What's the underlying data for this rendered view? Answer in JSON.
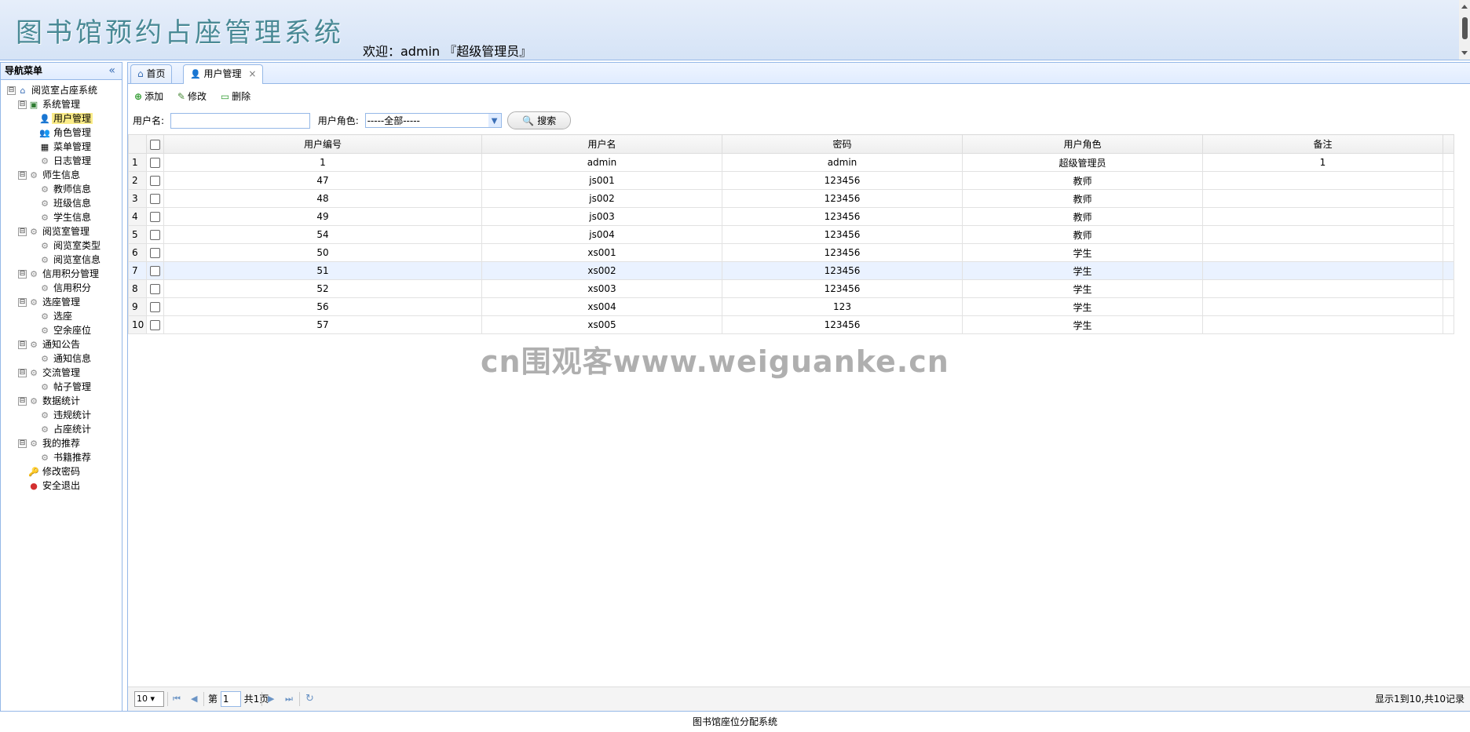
{
  "header": {
    "system_title": "图书馆预约占座管理系统",
    "welcome": "欢迎：admin 『超级管理员』"
  },
  "sidebar": {
    "title": "导航菜单",
    "tree": [
      {
        "label": "阅览室占座系统",
        "level": 0,
        "icon": "home-icon",
        "glyph": "⌂",
        "expander": "⊟"
      },
      {
        "label": "系统管理",
        "level": 1,
        "icon": "folder-icon",
        "glyph": "▣",
        "expander": "⊟"
      },
      {
        "label": "用户管理",
        "level": 2,
        "icon": "user-icon",
        "glyph": "👤",
        "selected": true
      },
      {
        "label": "角色管理",
        "level": 2,
        "icon": "role-icon",
        "glyph": "👥"
      },
      {
        "label": "菜单管理",
        "level": 2,
        "icon": "menu-icon",
        "glyph": "▦"
      },
      {
        "label": "日志管理",
        "level": 2,
        "icon": "gear-icon",
        "glyph": "⚙"
      },
      {
        "label": "师生信息",
        "level": 1,
        "icon": "gear-icon",
        "glyph": "⚙",
        "expander": "⊟"
      },
      {
        "label": "教师信息",
        "level": 2,
        "icon": "gear-icon",
        "glyph": "⚙"
      },
      {
        "label": "班级信息",
        "level": 2,
        "icon": "gear-icon",
        "glyph": "⚙"
      },
      {
        "label": "学生信息",
        "level": 2,
        "icon": "gear-icon",
        "glyph": "⚙"
      },
      {
        "label": "阅览室管理",
        "level": 1,
        "icon": "gear-icon",
        "glyph": "⚙",
        "expander": "⊟"
      },
      {
        "label": "阅览室类型",
        "level": 2,
        "icon": "gear-icon",
        "glyph": "⚙"
      },
      {
        "label": "阅览室信息",
        "level": 2,
        "icon": "gear-icon",
        "glyph": "⚙"
      },
      {
        "label": "信用积分管理",
        "level": 1,
        "icon": "gear-icon",
        "glyph": "⚙",
        "expander": "⊟"
      },
      {
        "label": "信用积分",
        "level": 2,
        "icon": "gear-icon",
        "glyph": "⚙"
      },
      {
        "label": "选座管理",
        "level": 1,
        "icon": "gear-icon",
        "glyph": "⚙",
        "expander": "⊟"
      },
      {
        "label": "选座",
        "level": 2,
        "icon": "gear-icon",
        "glyph": "⚙"
      },
      {
        "label": "空余座位",
        "level": 2,
        "icon": "gear-icon",
        "glyph": "⚙"
      },
      {
        "label": "通知公告",
        "level": 1,
        "icon": "gear-icon",
        "glyph": "⚙",
        "expander": "⊟"
      },
      {
        "label": "通知信息",
        "level": 2,
        "icon": "gear-icon",
        "glyph": "⚙"
      },
      {
        "label": "交流管理",
        "level": 1,
        "icon": "gear-icon",
        "glyph": "⚙",
        "expander": "⊟"
      },
      {
        "label": "帖子管理",
        "level": 2,
        "icon": "gear-icon",
        "glyph": "⚙"
      },
      {
        "label": "数据统计",
        "level": 1,
        "icon": "gear-icon",
        "glyph": "⚙",
        "expander": "⊟"
      },
      {
        "label": "违规统计",
        "level": 2,
        "icon": "gear-icon",
        "glyph": "⚙"
      },
      {
        "label": "占座统计",
        "level": 2,
        "icon": "gear-icon",
        "glyph": "⚙"
      },
      {
        "label": "我的推荐",
        "level": 1,
        "icon": "gear-icon",
        "glyph": "⚙",
        "expander": "⊟"
      },
      {
        "label": "书籍推荐",
        "level": 2,
        "icon": "gear-icon",
        "glyph": "⚙"
      },
      {
        "label": "修改密码",
        "level": 1,
        "icon": "key-icon",
        "glyph": "🔑"
      },
      {
        "label": "安全退出",
        "level": 1,
        "icon": "exit-icon",
        "glyph": "●"
      }
    ]
  },
  "tabs": [
    {
      "label": "首页",
      "icon": "home-icon",
      "glyph": "⌂"
    },
    {
      "label": "用户管理",
      "icon": "user-icon",
      "glyph": "👤",
      "close": "×"
    }
  ],
  "toolbar": {
    "add": "添加",
    "edit": "修改",
    "delete": "删除"
  },
  "search": {
    "username_label": "用户名:",
    "username_value": "",
    "role_label": "用户角色:",
    "role_value": "-----全部-----",
    "button": "搜索"
  },
  "grid": {
    "columns": [
      "用户编号",
      "用户名",
      "密码",
      "用户角色",
      "备注"
    ],
    "rows": [
      {
        "n": "1",
        "id": "1",
        "username": "admin",
        "password": "admin",
        "role": "超级管理员",
        "remark": "1"
      },
      {
        "n": "2",
        "id": "47",
        "username": "js001",
        "password": "123456",
        "role": "教师",
        "remark": ""
      },
      {
        "n": "3",
        "id": "48",
        "username": "js002",
        "password": "123456",
        "role": "教师",
        "remark": ""
      },
      {
        "n": "4",
        "id": "49",
        "username": "js003",
        "password": "123456",
        "role": "教师",
        "remark": ""
      },
      {
        "n": "5",
        "id": "54",
        "username": "js004",
        "password": "123456",
        "role": "教师",
        "remark": ""
      },
      {
        "n": "6",
        "id": "50",
        "username": "xs001",
        "password": "123456",
        "role": "学生",
        "remark": ""
      },
      {
        "n": "7",
        "id": "51",
        "username": "xs002",
        "password": "123456",
        "role": "学生",
        "remark": "",
        "highlight": true
      },
      {
        "n": "8",
        "id": "52",
        "username": "xs003",
        "password": "123456",
        "role": "学生",
        "remark": ""
      },
      {
        "n": "9",
        "id": "56",
        "username": "xs004",
        "password": "123",
        "role": "学生",
        "remark": ""
      },
      {
        "n": "10",
        "id": "57",
        "username": "xs005",
        "password": "123456",
        "role": "学生",
        "remark": ""
      }
    ]
  },
  "pager": {
    "page_size": "10",
    "page_prefix": "第",
    "page_value": "1",
    "page_suffix": "共1页",
    "info": "显示1到10,共10记录"
  },
  "footer": {
    "text": "图书馆座位分配系统"
  },
  "watermark": {
    "text": "cn围观客www.weiguanke.cn"
  }
}
